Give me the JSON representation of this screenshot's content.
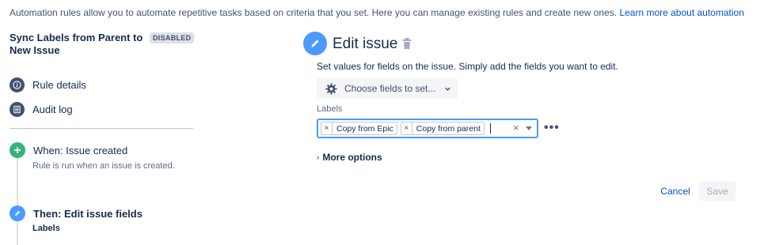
{
  "intro": {
    "text": "Automation rules allow you to automate repetitive tasks based on criteria that you set. Here you can manage existing rules and create new ones.",
    "link": "Learn more about automation"
  },
  "rule": {
    "title": "Sync Labels from Parent to New Issue",
    "status": "DISABLED"
  },
  "sidebar": {
    "links": [
      {
        "label": "Rule details",
        "icon": "info-icon"
      },
      {
        "label": "Audit log",
        "icon": "list-icon"
      }
    ]
  },
  "steps": {
    "trigger": {
      "title": "When: Issue created",
      "subtitle": "Rule is run when an issue is created.",
      "icon": "plus-icon",
      "color": "#36b37e"
    },
    "action": {
      "title": "Then: Edit issue fields",
      "subtitle": "Labels",
      "icon": "pencil-icon",
      "color": "#4c9aff"
    }
  },
  "editor": {
    "title": "Edit issue",
    "description": "Set values for fields on the issue. Simply add the fields you want to edit.",
    "choose_fields": "Choose fields to set...",
    "field_label": "Labels",
    "tags": [
      "Copy from Epic",
      "Copy from parent"
    ],
    "more_options": "More options",
    "cancel": "Cancel",
    "save": "Save"
  },
  "colors": {
    "accent": "#4c9aff",
    "link": "#0052cc",
    "trigger_green": "#36b37e",
    "sidebar_icon": "#42526e"
  }
}
